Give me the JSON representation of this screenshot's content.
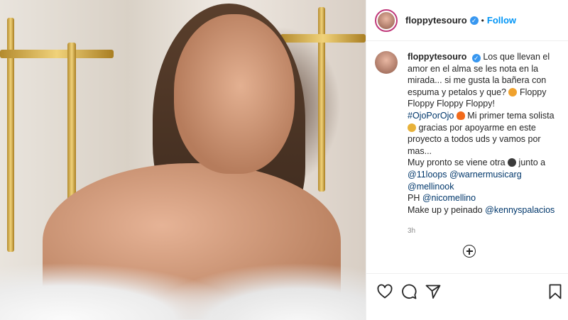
{
  "post": {
    "username": "floppytesouro",
    "separator": "•",
    "follow_label": "Follow",
    "verified_mark": "✓"
  },
  "caption": {
    "username": "floppytesouro",
    "text_1": "Los que llevan el amor en el alma se les nota en la mirada... si me gusta la bañera con espuma y petalos y que?",
    "text_2": "Floppy Floppy Floppy Floppy!",
    "hashtag": "#OjoPorOjo",
    "text_3": "Mi primer tema solista",
    "text_4": "gracias por apoyarme en este proyecto a todos uds y vamos por mas...",
    "text_5": "Muy pronto se viene otra",
    "text_6": "junto a",
    "mention_1": "@11loops",
    "mention_2": "@warnermusicarg",
    "mention_3": "@mellinook",
    "ph_label": "PH",
    "mention_4": "@nicomellino",
    "makeup_label": "Make up y peinado",
    "mention_5": "@kennyspalacios",
    "time": "3h"
  },
  "icons": {
    "add_comment": "plus-circle-icon",
    "like": "heart-icon",
    "comment": "comment-icon",
    "share": "share-icon",
    "save": "bookmark-icon"
  },
  "colors": {
    "accent": "#0095f6",
    "link": "#00376b",
    "verified": "#3897f0"
  }
}
